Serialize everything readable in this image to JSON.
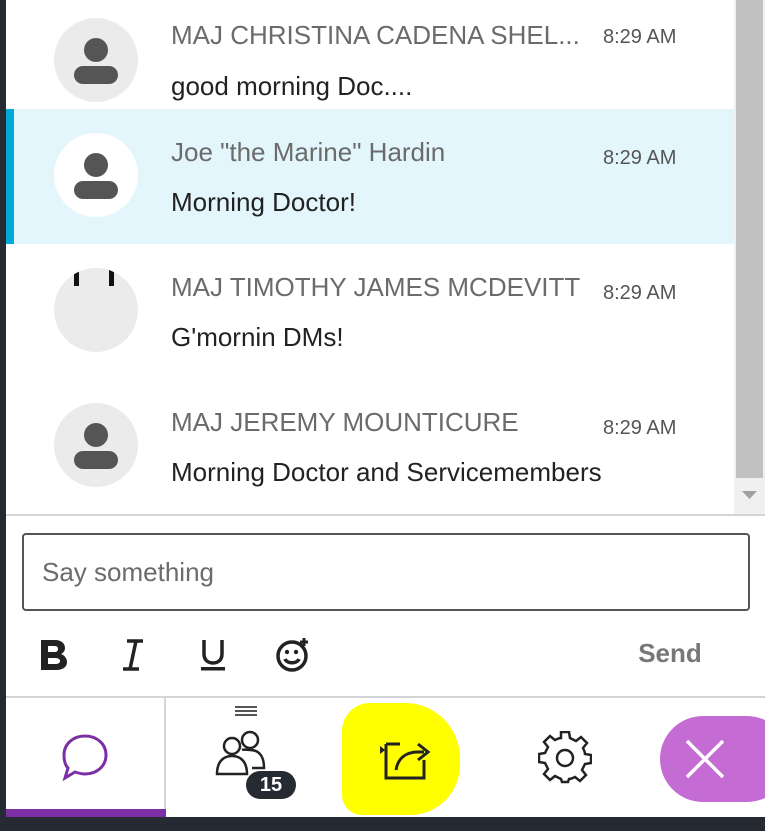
{
  "messages": [
    {
      "author": "MAJ CHRISTINA CADENA SHEL...",
      "time": "8:29 AM",
      "text": "good morning Doc....",
      "selected": false,
      "avatar": "default-person-icon"
    },
    {
      "author": "Joe \"the Marine\" Hardin",
      "time": "8:29 AM",
      "text": "Morning Doctor!",
      "selected": true,
      "avatar": "default-person-icon"
    },
    {
      "author": "MAJ TIMOTHY JAMES MCDEVITT",
      "time": "8:29 AM",
      "text": "G'mornin DMs!",
      "selected": false,
      "avatar": "custom-avatar"
    },
    {
      "author": "MAJ JEREMY MOUNTICURE",
      "time": "8:29 AM",
      "text": "Morning Doctor and Servicemembers",
      "selected": false,
      "avatar": "default-person-icon"
    }
  ],
  "composer": {
    "placeholder": "Say something",
    "value": "",
    "send_label": "Send"
  },
  "format_tools": [
    "bold-icon",
    "italic-icon",
    "underline-icon",
    "emoji-icon"
  ],
  "tabs": {
    "chat": {
      "icon": "chat-bubble-icon",
      "active": true
    },
    "people": {
      "icon": "people-icon",
      "count": "15"
    },
    "share": {
      "icon": "share-content-icon",
      "highlighted": true
    },
    "settings": {
      "icon": "gear-icon"
    },
    "close": {
      "icon": "close-icon"
    }
  },
  "colors": {
    "accent_purple": "#7c2fa5",
    "close_button": "#c46cd4",
    "selected_row": "#e3f6fc",
    "selected_bar": "#00a8d6",
    "highlight": "#ffff00"
  }
}
